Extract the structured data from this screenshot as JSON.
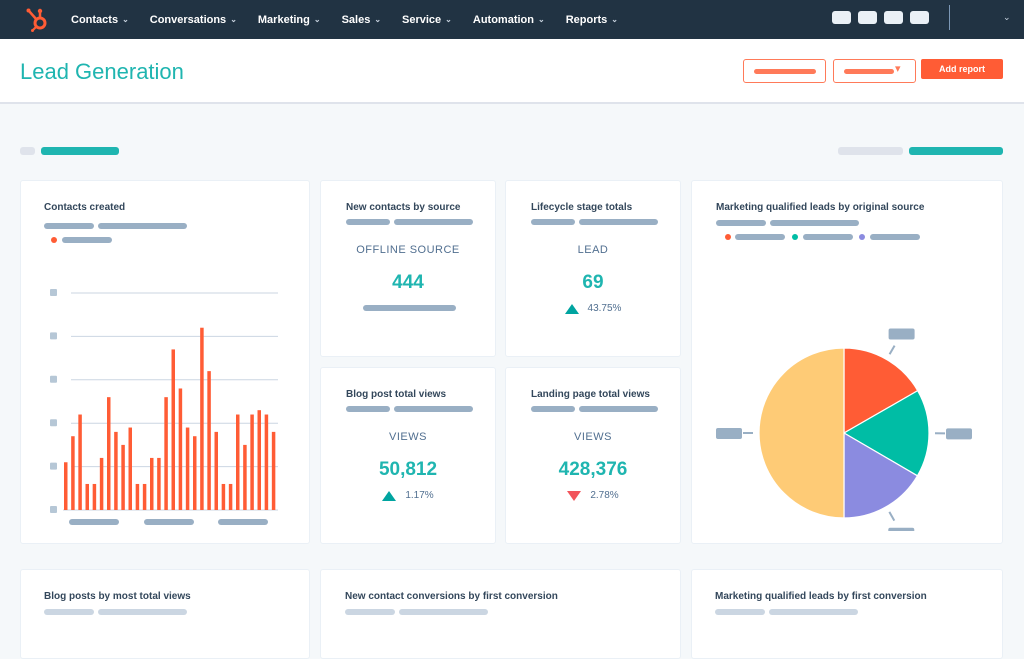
{
  "nav": {
    "items": [
      {
        "label": "Contacts"
      },
      {
        "label": "Conversations"
      },
      {
        "label": "Marketing"
      },
      {
        "label": "Sales"
      },
      {
        "label": "Service"
      },
      {
        "label": "Automation"
      },
      {
        "label": "Reports"
      }
    ],
    "chevron": "⌄",
    "logo_icon": "hubspot-sprocket-icon",
    "colors": {
      "bar": "#213343",
      "logo": "#ff5c35"
    }
  },
  "header": {
    "title": "Lead Generation",
    "add_report_label": "Add report",
    "dropdown_arrow": "▾"
  },
  "cards": {
    "contacts_created": {
      "title": "Contacts created"
    },
    "new_contacts_by_source": {
      "title": "New contacts by source",
      "label": "OFFLINE SOURCE",
      "value": "444"
    },
    "lifecycle_stage_totals": {
      "title": "Lifecycle stage totals",
      "label": "LEAD",
      "value": "69",
      "delta": "43.75%",
      "direction": "up"
    },
    "blog_post_total_views": {
      "title": "Blog post total views",
      "label": "VIEWS",
      "value": "50,812",
      "delta": "1.17%",
      "direction": "up"
    },
    "landing_page_total_views": {
      "title": "Landing page total views",
      "label": "VIEWS",
      "value": "428,376",
      "delta": "2.78%",
      "direction": "down"
    },
    "mql_by_original_source": {
      "title": "Marketing qualified leads by original source"
    },
    "blog_posts_by_views": {
      "title": "Blog posts by most total views"
    },
    "new_contact_conversions": {
      "title": "New contact conversions by first conversion"
    },
    "mql_by_first_conversion": {
      "title": "Marketing qualified leads by first conversion"
    }
  },
  "colors": {
    "accent_teal": "#1fb5b0",
    "brand_orange": "#ff5c35",
    "up": "#00a4a0",
    "down": "#f2545b"
  },
  "chart_data": [
    {
      "type": "bar",
      "title": "Contacts created",
      "values": [
        1.1,
        1.7,
        2.2,
        0.6,
        0.6,
        1.2,
        2.6,
        1.8,
        1.5,
        1.9,
        0.6,
        0.6,
        1.2,
        1.2,
        2.6,
        3.7,
        2.8,
        1.9,
        1.7,
        4.2,
        3.2,
        1.8,
        0.6,
        0.6,
        2.2,
        1.5,
        2.2,
        2.3,
        2.2,
        1.8
      ],
      "ylim": [
        0,
        5
      ],
      "grid": true,
      "color": "#ff5c35"
    },
    {
      "type": "pie",
      "title": "Marketing qualified leads by original source",
      "slices": [
        {
          "value": 16.7,
          "color": "#ff5c35"
        },
        {
          "value": 16.7,
          "color": "#00bda5"
        },
        {
          "value": 16.6,
          "color": "#8b8be0"
        },
        {
          "value": 50.0,
          "color": "#fecb76"
        }
      ]
    }
  ]
}
